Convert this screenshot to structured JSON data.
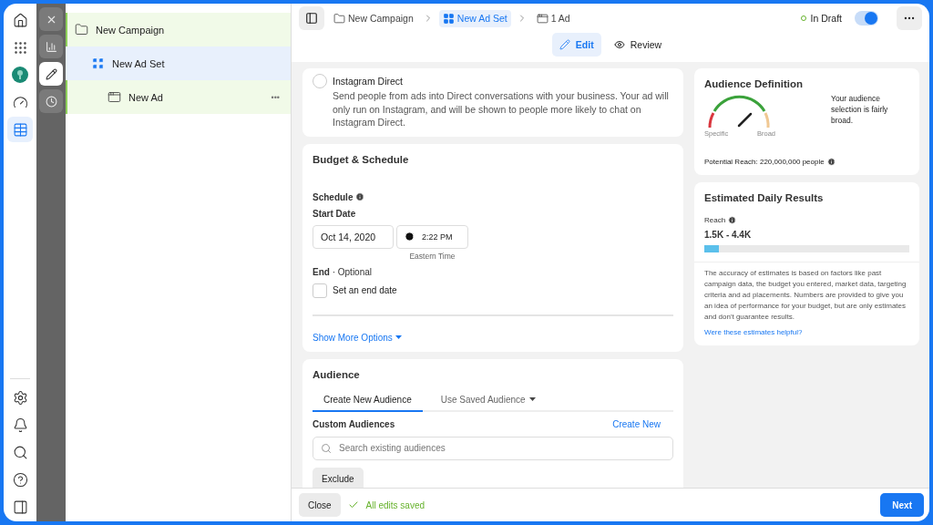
{
  "rail": {
    "top": [
      {
        "selected": false
      },
      {
        "selected": false
      },
      {
        "selected": false
      },
      {
        "selected": false
      },
      {
        "selected": true
      }
    ],
    "bottom": [
      {
        "selected": false
      },
      {
        "selected": false
      },
      {
        "selected": false
      },
      {
        "selected": false
      },
      {
        "selected": false
      }
    ]
  },
  "tools": [
    {
      "kind": "close",
      "selected": false
    },
    {
      "kind": "chart",
      "selected": false
    },
    {
      "kind": "edit",
      "selected": true
    },
    {
      "kind": "history",
      "selected": false
    }
  ],
  "tree": [
    {
      "kind": "campaign",
      "label": "New Campaign",
      "selected": false,
      "children": [
        {
          "kind": "adset",
          "label": "New Ad Set",
          "selected": true,
          "children": [
            {
              "kind": "ad",
              "label": "New Ad",
              "selected": false,
              "more": "•••"
            }
          ]
        }
      ]
    }
  ],
  "breadcrumb": [
    {
      "kind": "campaign",
      "label": "New Campaign",
      "selected": false
    },
    {
      "kind": "adset",
      "label": "New Ad Set",
      "selected": true
    },
    {
      "kind": "ad",
      "label": "1 Ad",
      "selected": false
    }
  ],
  "status": {
    "label": "In Draft",
    "on": true
  },
  "mode_tabs": [
    {
      "kind": "edit",
      "label": "Edit",
      "selected": true
    },
    {
      "kind": "review",
      "label": "Review",
      "selected": false
    }
  ],
  "placement": {
    "title": "Instagram Direct",
    "description": "Send people from ads into Direct conversations with your business. Your ad will only run on Instagram, and will be shown to people more likely to chat on Instagram Direct.",
    "selected": false
  },
  "budget": {
    "title": "Budget & Schedule",
    "schedule_label": "Schedule",
    "start_label": "Start Date",
    "date": "Oct 14, 2020",
    "time": "2:22 PM",
    "timezone": "Eastern Time",
    "end_label": "**End** · Optional",
    "end_checkbox": {
      "label": "Set an end date",
      "checked": false
    },
    "more_link": "Show More Options"
  },
  "audience": {
    "title": "Audience",
    "tabs": [
      {
        "label": "Create New Audience",
        "selected": true,
        "dropdown": false
      },
      {
        "label": "Use Saved Audience",
        "selected": false,
        "dropdown": true
      }
    ],
    "custom_label": "Custom Audiences",
    "create_link": "Create New",
    "search_placeholder": "Search existing audiences",
    "exclude": "Exclude"
  },
  "audience_definition": {
    "title": "Audience Definition",
    "gauge": {
      "min_label": "Specific",
      "max_label": "Broad"
    },
    "verdict": "Your audience selection is fairly broad.",
    "reach": "Potential Reach: 220,000,000 people"
  },
  "estimates": {
    "title": "Estimated Daily Results",
    "reach_label": "Reach",
    "range": "1.5K - 4.4K",
    "level": 0.07,
    "disclaimer": "The accuracy of estimates is based on factors like past campaign data, the budget you entered, market data, targeting criteria and ad placements. Numbers are provided to give you an idea of performance for your budget, but are only estimates and don't guarantee results.",
    "feedback_link": "Were these estimates helpful?"
  },
  "footer": {
    "close": "Close",
    "saved": "All edits saved",
    "next": "Next"
  }
}
